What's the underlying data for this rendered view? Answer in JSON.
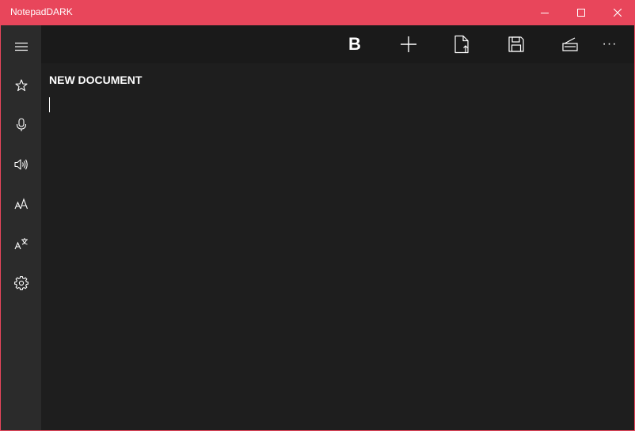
{
  "window": {
    "title": "NotepadDARK"
  },
  "colors": {
    "accent": "#e8465b",
    "sidebar": "#2b2b2b",
    "background": "#1e1e1e",
    "toolbar": "#1a1a1a"
  },
  "sidebar": {
    "items": [
      {
        "icon": "hamburger-menu-icon"
      },
      {
        "icon": "star-icon"
      },
      {
        "icon": "microphone-icon"
      },
      {
        "icon": "speaker-icon"
      },
      {
        "icon": "font-size-icon"
      },
      {
        "icon": "translate-icon"
      },
      {
        "icon": "gear-icon"
      }
    ]
  },
  "toolbar": {
    "bold_label": "B",
    "more_label": "···",
    "icons": [
      "bold-icon",
      "add-icon",
      "open-file-icon",
      "save-icon",
      "scanner-icon",
      "more-icon"
    ]
  },
  "document": {
    "title": "NEW DOCUMENT",
    "content": ""
  }
}
